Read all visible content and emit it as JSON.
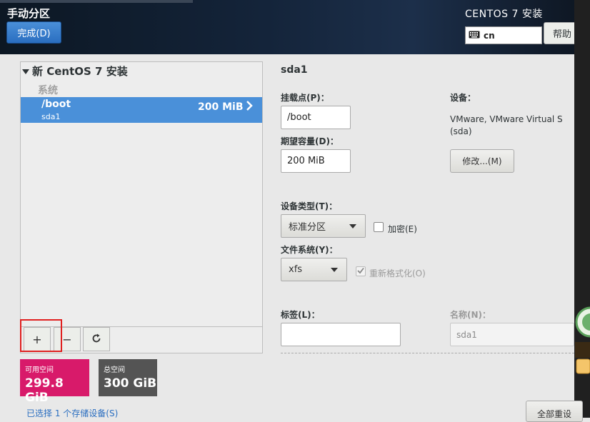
{
  "header": {
    "title": "手动分区",
    "done_label": "完成(D)",
    "installer_title": "CENTOS 7 安装",
    "keyboard_layout": "cn",
    "help_label": "帮助"
  },
  "tree": {
    "root_label": "新 CentOS 7 安装",
    "section_label": "系统",
    "selected_item": {
      "mount": "/boot",
      "device": "sda1",
      "size": "200 MiB"
    }
  },
  "toolbar": {
    "add_label": "+",
    "remove_label": "−",
    "refresh_label": "↻"
  },
  "space": {
    "available_label": "可用空间",
    "available_value": "299.8 GiB",
    "total_label": "总空间",
    "total_value": "300 GiB"
  },
  "selected_devices_link": "已选择 1 个存储设备(S)",
  "details": {
    "title": "sda1",
    "mount_point_label": "挂载点(P)：",
    "mount_point_value": "/boot",
    "capacity_label": "期望容量(D)：",
    "capacity_value": "200 MiB",
    "device_label": "设备：",
    "device_value_line1": "VMware, VMware Virtual S",
    "device_value_line2": "(sda)",
    "modify_label": "修改...(M)",
    "device_type_label": "设备类型(T)：",
    "device_type_value": "标准分区",
    "encrypt_label": "加密(E)",
    "filesystem_label": "文件系统(Y)：",
    "filesystem_value": "xfs",
    "reformat_label": "重新格式化(O)",
    "tag_label": "标签(L)：",
    "tag_value": "",
    "name_label": "名称(N)：",
    "name_value": "sda1",
    "reset_label": "全部重设"
  },
  "colors": {
    "selected_row": "#4a90d9",
    "available_space": "#d81a6a",
    "total_space": "#545454",
    "highlight_box": "#e02020"
  }
}
